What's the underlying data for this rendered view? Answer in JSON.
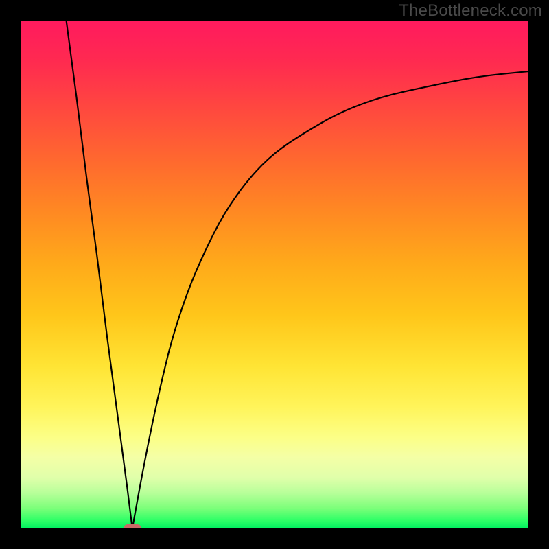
{
  "watermark": "TheBottleneck.com",
  "colors": {
    "frame_bg": "#000000",
    "curve_stroke": "#000000",
    "marker_fill": "#c96a66",
    "gradient_stops": [
      "#ff1a5e",
      "#ff2a50",
      "#ff4a3e",
      "#ff6a2e",
      "#ff8a22",
      "#ffaa1a",
      "#ffc61a",
      "#ffe434",
      "#fff45a",
      "#fcff86",
      "#f4ffa6",
      "#e0ffaa",
      "#b8ff9a",
      "#7cff7a",
      "#2cff66",
      "#00f060"
    ]
  },
  "chart_data": {
    "type": "line",
    "title": "",
    "xlabel": "",
    "ylabel": "",
    "xlim": [
      0,
      100
    ],
    "ylim": [
      0,
      100
    ],
    "minimum_x": 22,
    "marker": {
      "x": 22,
      "y": 0
    },
    "series": [
      {
        "name": "bottleneck-curve-left",
        "description": "Steep straight descent from top-left down to the minimum",
        "x": [
          9,
          11,
          13,
          15,
          17,
          19,
          21,
          22
        ],
        "values": [
          100,
          85,
          69,
          54,
          38,
          23,
          8,
          0
        ]
      },
      {
        "name": "bottleneck-curve-right",
        "description": "Concave rise from the minimum that flattens toward the right edge",
        "x": [
          22,
          24,
          26,
          28,
          30,
          33,
          36,
          40,
          45,
          50,
          56,
          63,
          71,
          80,
          90,
          100
        ],
        "values": [
          0,
          11,
          21,
          30,
          38,
          47,
          54,
          62,
          69,
          74,
          78,
          82,
          85,
          87,
          89,
          90
        ]
      }
    ]
  }
}
